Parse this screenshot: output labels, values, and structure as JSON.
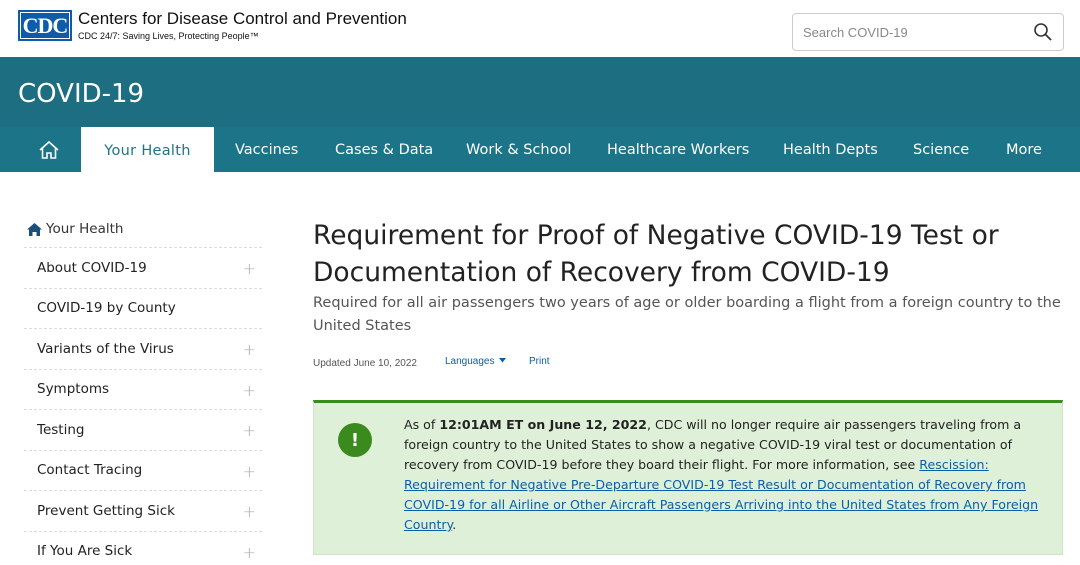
{
  "header": {
    "logo_text": "CDC",
    "org_name": "Centers for Disease Control and Prevention",
    "tagline": "CDC 24/7: Saving Lives, Protecting People™",
    "search_placeholder": "Search COVID-19"
  },
  "site": {
    "title": "COVID-19"
  },
  "nav": {
    "items": [
      {
        "label": "Your Health",
        "active": true
      },
      {
        "label": "Vaccines"
      },
      {
        "label": "Cases & Data"
      },
      {
        "label": "Work & School"
      },
      {
        "label": "Healthcare Workers"
      },
      {
        "label": "Health Depts"
      },
      {
        "label": "Science"
      },
      {
        "label": "More"
      }
    ]
  },
  "sidebar": {
    "heading": "Your Health",
    "items": [
      {
        "label": "About COVID-19",
        "expandable": true
      },
      {
        "label": "COVID-19 by County",
        "expandable": false
      },
      {
        "label": "Variants of the Virus",
        "expandable": true
      },
      {
        "label": "Symptoms",
        "expandable": true
      },
      {
        "label": "Testing",
        "expandable": true
      },
      {
        "label": "Contact Tracing",
        "expandable": true
      },
      {
        "label": "Prevent Getting Sick",
        "expandable": true
      },
      {
        "label": "If You Are Sick",
        "expandable": true
      }
    ],
    "plus": "+"
  },
  "main": {
    "title": "Requirement for Proof of Negative COVID-19 Test or Documentation of Recovery from COVID-19",
    "subtitle": "Required for all air passengers two years of age or older boarding a flight from a foreign country to the United States",
    "updated": "Updated June 10, 2022",
    "languages": "Languages",
    "print": "Print"
  },
  "alert": {
    "icon": "!",
    "prefix": "As of ",
    "bold": "12:01AM ET on June 12, 2022",
    "body": ", CDC will no longer require air passengers traveling from a foreign country to the United States to show a negative COVID-19 viral test or documentation of recovery from COVID-19 before they board their flight. For more information, see ",
    "link": "Rescission: Requirement for Negative Pre-Departure COVID-19 Test Result or Documentation of Recovery from COVID-19 for all Airline or Other Aircraft Passengers Arriving into the United States from Any Foreign Country",
    "suffix": "."
  },
  "colors": {
    "brand_blue": "#0d5caa",
    "teal": "#1c6e80",
    "alert_green": "#3a8a1e",
    "alert_bg": "#dff0d8",
    "link": "#0b5ea8"
  }
}
